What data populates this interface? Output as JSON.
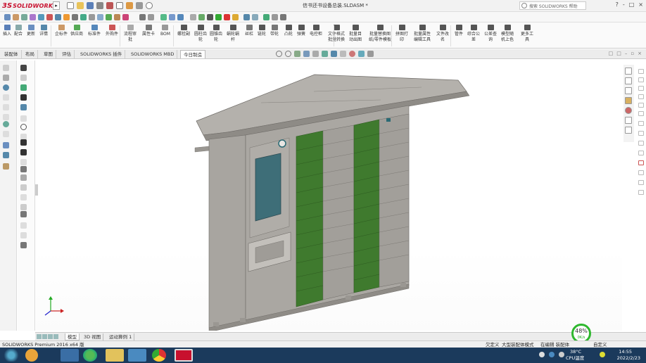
{
  "app": {
    "logo_mark": "3S",
    "logo_text": "SOLIDWORKS",
    "document_title": "信书还书设备总装.SLDASM *"
  },
  "help_search": {
    "placeholder": "搜索 SOLIDWORKS 帮助"
  },
  "title_controls": [
    "?",
    "-",
    "□",
    "×"
  ],
  "ribbon": {
    "items": [
      {
        "label1": "插入",
        "label2": ""
      },
      {
        "label1": "配合",
        "label2": ""
      },
      {
        "label1": "更新",
        "label2": ""
      },
      {
        "label1": "详情",
        "label2": ""
      },
      {
        "label1": "企标件",
        "label2": ""
      },
      {
        "label1": "供应商",
        "label2": ""
      },
      {
        "label1": "标准件",
        "label2": ""
      },
      {
        "label1": "外购件",
        "label2": ""
      },
      {
        "label1": "流程审",
        "label2": "批"
      },
      {
        "label1": "属性卡",
        "label2": ""
      },
      {
        "label1": "BOM",
        "label2": ""
      },
      {
        "label1": "螺栓副",
        "label2": ""
      },
      {
        "label1": "圆柱齿",
        "label2": "轮"
      },
      {
        "label1": "圆锥齿",
        "label2": "轮"
      },
      {
        "label1": "蜗轮蜗",
        "label2": "杆"
      },
      {
        "label1": "丝杠",
        "label2": ""
      },
      {
        "label1": "链轮",
        "label2": ""
      },
      {
        "label1": "带轮",
        "label2": ""
      },
      {
        "label1": "凸轮",
        "label2": ""
      },
      {
        "label1": "弹簧",
        "label2": ""
      },
      {
        "label1": "电控柜",
        "label2": ""
      },
      {
        "label1": "文件格式",
        "label2": "批量转换"
      },
      {
        "label1": "批量目",
        "label2": "动出图"
      },
      {
        "label1": "批量替换图",
        "label2": "纸/零件模板"
      },
      {
        "label1": "拼图打",
        "label2": "印"
      },
      {
        "label1": "批量属性",
        "label2": "编辑工具"
      },
      {
        "label1": "文件改",
        "label2": "名"
      },
      {
        "label1": "管件",
        "label2": ""
      },
      {
        "label1": "综合公",
        "label2": "差"
      },
      {
        "label1": "公差查",
        "label2": "询"
      },
      {
        "label1": "模型随",
        "label2": "机上色"
      },
      {
        "label1": "更多工",
        "label2": "具"
      }
    ]
  },
  "tabs": [
    "装配体",
    "布局",
    "草图",
    "评估",
    "SOLIDWORKS 插件",
    "SOLIDWORKS MBD",
    "今日制造"
  ],
  "active_tab": "今日制造",
  "bottom_tabs": [
    "模型",
    "3D 视图",
    "运动算例 1"
  ],
  "status": {
    "product": "SOLIDWORKS Premium 2016 x64 版",
    "s1": "欠定义",
    "s2": "大型装配体模式",
    "s3": "在编辑 装配体",
    "s4": "自定义"
  },
  "perf": {
    "percent": "48%",
    "speed": "0K/s"
  },
  "tray": {
    "temp": "38°C",
    "temp_label": "CPU温度",
    "time": "14:55",
    "date": "2022/2/23"
  },
  "colors": {
    "cabinet_body": "#a8a5a0",
    "cabinet_dark": "#8a8782",
    "door_green": "#3f7a2e",
    "roof": "#b4b1ac",
    "glass": "#3e6e78",
    "taskbar": "#1b3a5c",
    "brand_red": "#c8102e"
  }
}
